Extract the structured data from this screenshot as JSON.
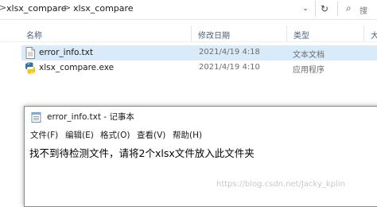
{
  "address_bar": {
    "crumbs": [
      "xlsx_compare",
      "xlsx_compare"
    ],
    "separators": [
      ">",
      ">"
    ],
    "search_placeholder": "搜"
  },
  "columns": {
    "name": "名称",
    "date": "修改日期",
    "type": "类型",
    "size": "大"
  },
  "files": [
    {
      "name": "error_info.txt",
      "date": "2021/4/19 4:18",
      "type": "文本文档",
      "icon": "text-file-icon"
    },
    {
      "name": "xlsx_compare.exe",
      "date": "2021/4/19 4:10",
      "type": "应用程序",
      "icon": "python-exe-icon"
    }
  ],
  "notepad": {
    "title": "error_info.txt - 记事本",
    "menu": [
      "文件(F)",
      "编辑(E)",
      "格式(O)",
      "查看(V)",
      "帮助(H)"
    ],
    "content": "找不到待检测文件，请将2个xlsx文件放入此文件夹"
  },
  "watermark": "https://blog.csdn.net/Jacky_kplin",
  "colors": {
    "selection": "#d9ebf9",
    "header_text": "#4c607a"
  }
}
